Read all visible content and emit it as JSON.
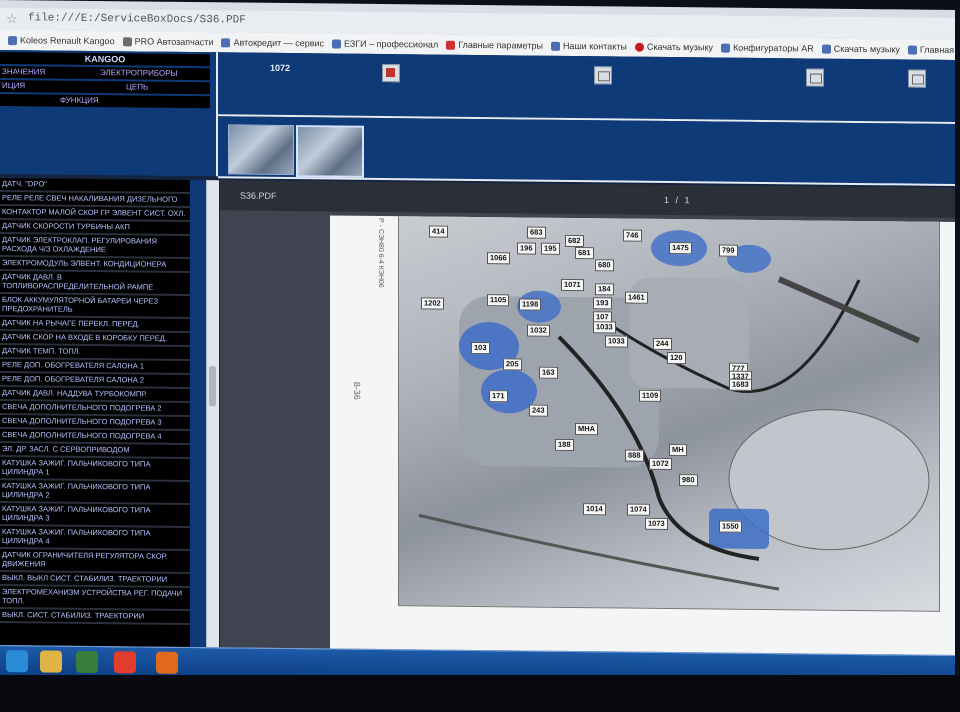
{
  "browser": {
    "url": "file:///E:/ServiceBoxDocs/S36.PDF"
  },
  "bookmarks": [
    {
      "label": "Koleos Renault Kangoo"
    },
    {
      "label": "PRO Автозапчасти"
    },
    {
      "label": "Автокредит — сервис"
    },
    {
      "label": "ЕЗГИ – профессионал"
    },
    {
      "label": "Главные параметры"
    },
    {
      "label": "Наши контакты"
    },
    {
      "label": "Скачать музыку"
    },
    {
      "label": "Конфигураторы AR"
    },
    {
      "label": "Скачать музыку"
    },
    {
      "label": "Главная иноf"
    }
  ],
  "left_header": {
    "vehicle": "KANGOO",
    "row1_left": "ЗНАЧЕНИЯ",
    "row1_right": "ЭЛЕКТРОПРИБОРЫ",
    "row2_left": "ИЦИЯ",
    "row2_right": "ЦЕПЬ",
    "row3": "ФУНКЦИЯ"
  },
  "toolbar": {
    "doc_number": "1072"
  },
  "list_items": [
    "ДАТЧ. \"DPO\"",
    "РЕЛЕ РЕЛЕ СВЕЧ НАКАЛИВАНИЯ ДИЗЕЛЬНОГО",
    "КОНТАКТОР МАЛОЙ СКОР ГР ЭЛВЕНТ СИСТ. ОХЛ.",
    "ДАТЧИК СКОРОСТИ ТУРБИНЫ АКП",
    "ДАТЧИК ЭЛЕКТРОКЛАП. РЕГУЛИРОВАНИЯ РАСХОДА Ч/З ОХЛАЖДЕНИЕ",
    "ЭЛЕКТРОМОДУЛЬ ЭЛВЕНТ. КОНДИЦИОНЕРА",
    "ДАТЧИК ДАВЛ. В ТОПЛИВОРАСПРЕДЕЛИТЕЛЬНОЙ РАМПЕ",
    "БЛОК АККУМУЛЯТОРНОЙ БАТАРЕИ ЧЕРЕЗ ПРЕДОХРАНИТЕЛЬ",
    "ДАТЧИК НА РЫЧАГЕ ПЕРЕКЛ. ПЕРЕД.",
    "ДАТЧИК СКОР НА ВХОДЕ В КОРОБКУ ПЕРЕД.",
    "ДАТЧИК ТЕМП. ТОПЛ.",
    "РЕЛЕ ДОП. ОБОГРЕВАТЕЛЯ САЛОНА 1",
    "РЕЛЕ ДОП. ОБОГРЕВАТЕЛЯ САЛОНА 2",
    "ДАТЧИК ДАВЛ. НАДДУВА ТУРБОКОМПР.",
    "СВЕЧА ДОПОЛНИТЕЛЬНОГО ПОДОГРЕВА 2",
    "СВЕЧА ДОПОЛНИТЕЛЬНОГО ПОДОГРЕВА 3",
    "СВЕЧА ДОПОЛНИТЕЛЬНОГО ПОДОГРЕВА 4",
    "ЭЛ. ДР. ЗАСЛ. С СЕРВОПРИВОДОМ",
    "КАТУШКА ЗАЖИГ. ПАЛЬЧИКОВОГО ТИПА ЦИЛИНДРА 1",
    "КАТУШКА ЗАЖИГ. ПАЛЬЧИКОВОГО ТИПА ЦИЛИНДРА 2",
    "КАТУШКА ЗАЖИГ. ПАЛЬЧИКОВОГО ТИПА ЦИЛИНДРА 3",
    "КАТУШКА ЗАЖИГ. ПАЛЬЧИКОВОГО ТИПА ЦИЛИНДРА 4",
    "ДАТЧИК ОГРАНИЧИТЕЛЯ РЕГУЛЯТОРА СКОР. ДВИЖЕНИЯ",
    "ВЫКЛ. ВЫКЛ СИСТ. СТАБИЛИЗ. ТРАЕКТОРИИ",
    "ЭЛЕКТРОМЕХАНИЗМ УСТРОЙСТВА РЕГ. ПОДАЧИ ТОПЛ.",
    "ВЫКЛ. СИСТ. СТАБИЛИЗ. ТРАЕКТОРИИ"
  ],
  "viewer": {
    "file_name": "S36.PDF",
    "page_indicator": "1 / 1",
    "page_label": "8-36",
    "side_reference": "Р - СЭН80 6-4 КЭН06"
  },
  "callouts": [
    {
      "text": "414"
    },
    {
      "text": "683"
    },
    {
      "text": "682"
    },
    {
      "text": "196"
    },
    {
      "text": "195"
    },
    {
      "text": "681"
    },
    {
      "text": "746"
    },
    {
      "text": "1475"
    },
    {
      "text": "799"
    },
    {
      "text": "1066"
    },
    {
      "text": "680"
    },
    {
      "text": "1071"
    },
    {
      "text": "184"
    },
    {
      "text": "1461"
    },
    {
      "text": "1202"
    },
    {
      "text": "1105"
    },
    {
      "text": "1198"
    },
    {
      "text": "193"
    },
    {
      "text": "107"
    },
    {
      "text": "1033"
    },
    {
      "text": "1032"
    },
    {
      "text": "1033"
    },
    {
      "text": "244"
    },
    {
      "text": "103"
    },
    {
      "text": "120"
    },
    {
      "text": "777"
    },
    {
      "text": "1337"
    },
    {
      "text": "1683"
    },
    {
      "text": "205"
    },
    {
      "text": "163"
    },
    {
      "text": "171"
    },
    {
      "text": "1109"
    },
    {
      "text": "243"
    },
    {
      "text": "MHA"
    },
    {
      "text": "188"
    },
    {
      "text": "MH"
    },
    {
      "text": "888"
    },
    {
      "text": "1072"
    },
    {
      "text": "980"
    },
    {
      "text": "1014"
    },
    {
      "text": "1074"
    },
    {
      "text": "1073"
    },
    {
      "text": "1550"
    }
  ],
  "taskbar": {
    "icons": [
      "ie-icon",
      "explorer-icon",
      "media-player-icon",
      "chrome-icon",
      "firefox-icon"
    ]
  },
  "colors": {
    "app_blue": "#0f3a78",
    "list_bg": "#000000",
    "list_text": "#b9c3ff",
    "taskbar": "#1d5aa8"
  }
}
